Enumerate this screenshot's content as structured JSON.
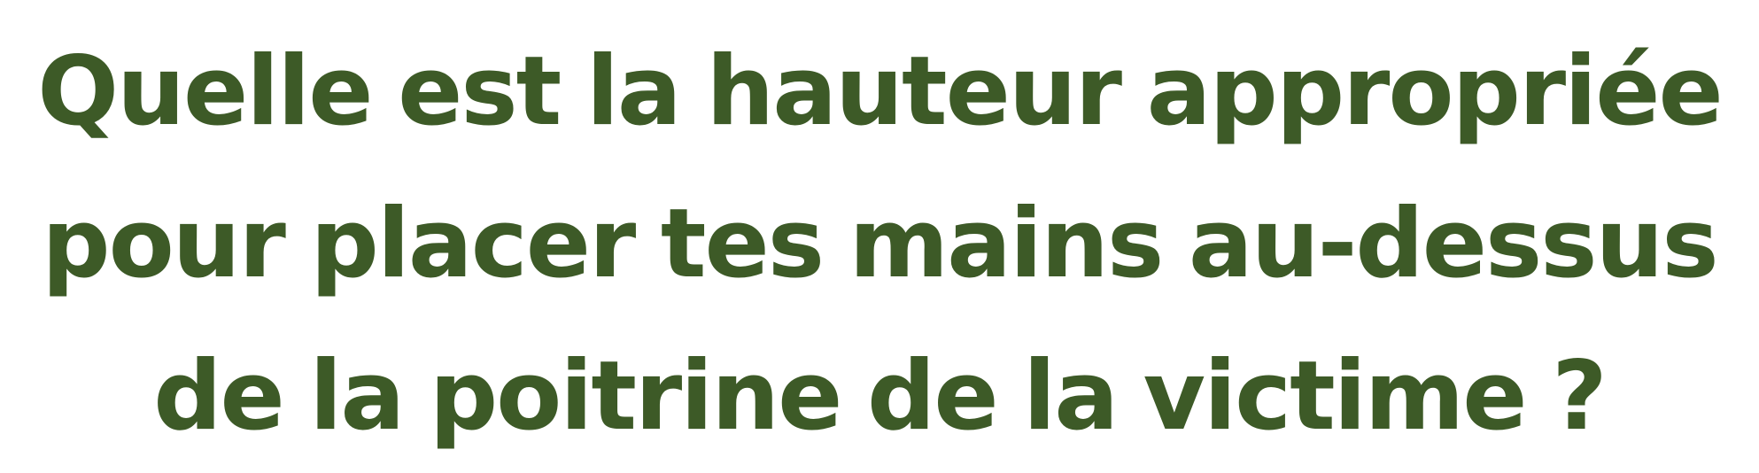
{
  "question": {
    "line_1": "Quelle est la hauteur appropriée",
    "line_2": "pour placer tes mains au-dessus",
    "line_3": "de la poitrine de la victime ?"
  },
  "colors": {
    "text": "#3d5a27",
    "background": "#ffffff"
  }
}
